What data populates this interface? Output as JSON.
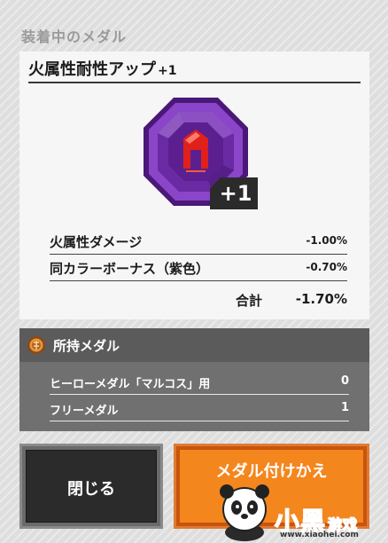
{
  "header": {
    "title": "装着中のメダル"
  },
  "medal": {
    "name": "火属性耐性アップ",
    "level": "+1",
    "badge": "+1",
    "icon": "fire-house-medal-icon",
    "colors": {
      "frame": "#7a34b8",
      "core": "#5c1f8f",
      "emblem": "#e0201b"
    }
  },
  "stats": [
    {
      "label": "火属性ダメージ",
      "value": "-1.00%"
    },
    {
      "label": "同カラーボーナス（紫色）",
      "value": "-0.70%"
    }
  ],
  "total": {
    "label": "合計",
    "value": "-1.70%"
  },
  "owned": {
    "title": "所持メダル",
    "icon": "medal-coin-icon",
    "rows": [
      {
        "label": "ヒーローメダル「マルコス」用",
        "value": "0"
      },
      {
        "label": "フリーメダル",
        "value": "1"
      }
    ]
  },
  "buttons": {
    "close": "閉じる",
    "change": "メダル付けかえ",
    "close_color": "#2b2b2b",
    "change_color": "#f4861e"
  },
  "watermark": {
    "brand": "小黑",
    "sub": "游戏",
    "url": "www.xiaohei.com"
  }
}
